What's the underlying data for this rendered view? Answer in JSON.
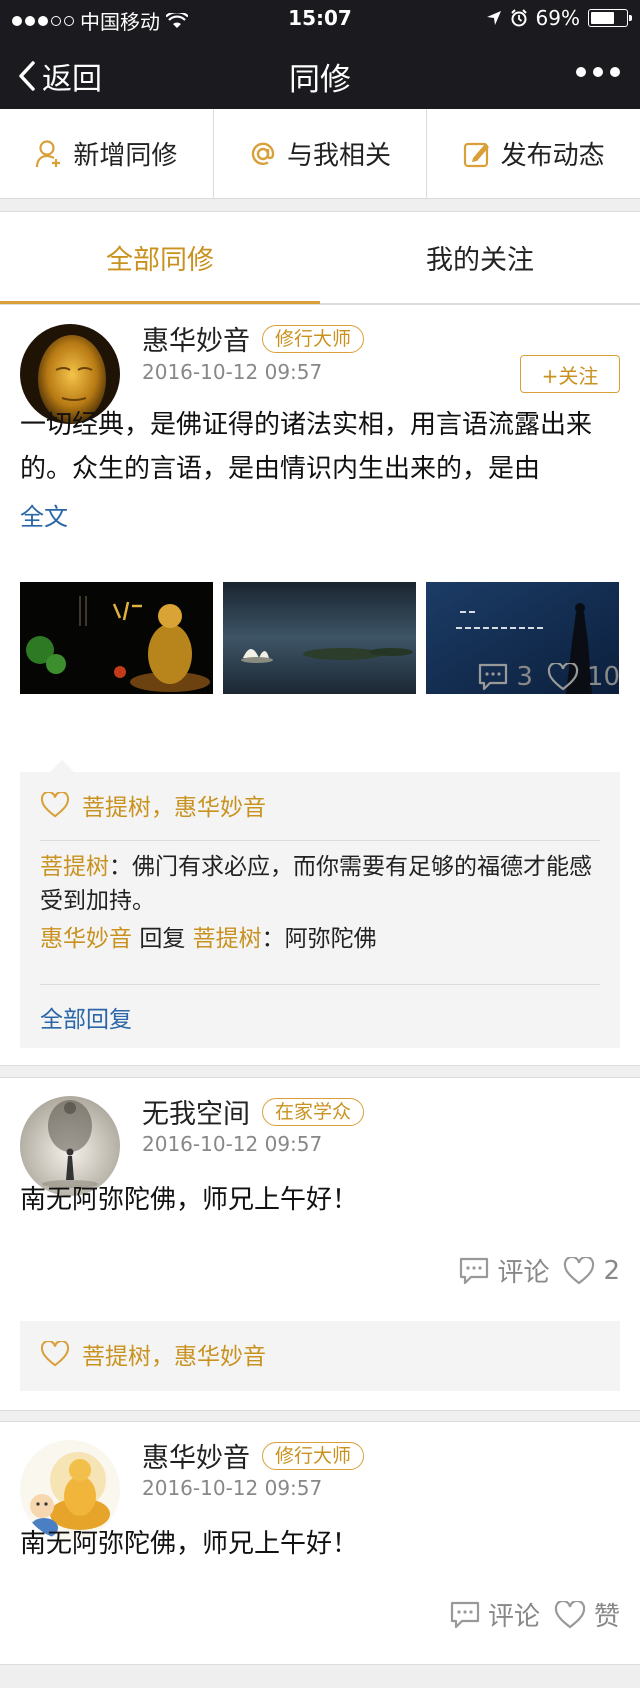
{
  "status": {
    "carrier": "中国移动",
    "time": "15:07",
    "battery_text": "69%",
    "battery_level": 0.69,
    "signal_bars_filled": 3,
    "signal_bars_total": 5
  },
  "nav": {
    "back_label": "返回",
    "title": "同修",
    "more_icon": "ellipsis-icon"
  },
  "actions": [
    {
      "label": "新增同修",
      "icon": "add-user-icon"
    },
    {
      "label": "与我相关",
      "icon": "at-icon"
    },
    {
      "label": "发布动态",
      "icon": "edit-icon"
    }
  ],
  "tabs": [
    {
      "label": "全部同修",
      "active": true
    },
    {
      "label": "我的关注",
      "active": false
    }
  ],
  "colors": {
    "accent": "#c9921f",
    "link": "#2a66a8",
    "header_bg": "#1b1b1f"
  },
  "posts": [
    {
      "user": "惠华妙音",
      "badge": "修行大师",
      "date": "2016-10-12 09:57",
      "follow_label": "+关注",
      "content": "一切经典，是佛证得的诸法实相，用言语流露出来的。众生的言语，是由情识内生出来的，是由",
      "fulltext_label": "全文",
      "images": [
        "buddha-statue-image",
        "lotus-pond-image",
        "silhouette-image"
      ],
      "comments_count": "3",
      "likes_count": "10",
      "likes_users": [
        "菩提树",
        "惠华妙音"
      ],
      "likes_sep": "，",
      "comments": [
        {
          "user": "菩提树",
          "text": "：佛门有求必应，而你需要有足够的福德才能感受到加持。"
        },
        {
          "user": "惠华妙音",
          "reply_word": "回复",
          "reply_to": "菩提树",
          "text": "：阿弥陀佛"
        }
      ],
      "all_replies_label": "全部回复"
    },
    {
      "user": "无我空间",
      "badge": "在家学众",
      "date": "2016-10-12 09:57",
      "content": "南无阿弥陀佛，师兄上午好！",
      "comment_label": "评论",
      "likes_count": "2",
      "likes_users": [
        "菩提树",
        "惠华妙音"
      ],
      "likes_sep": "，"
    },
    {
      "user": "惠华妙音",
      "badge": "修行大师",
      "date": "2016-10-12 09:57",
      "content": "南无阿弥陀佛，师兄上午好！",
      "comment_label": "评论",
      "like_label": "赞"
    }
  ]
}
